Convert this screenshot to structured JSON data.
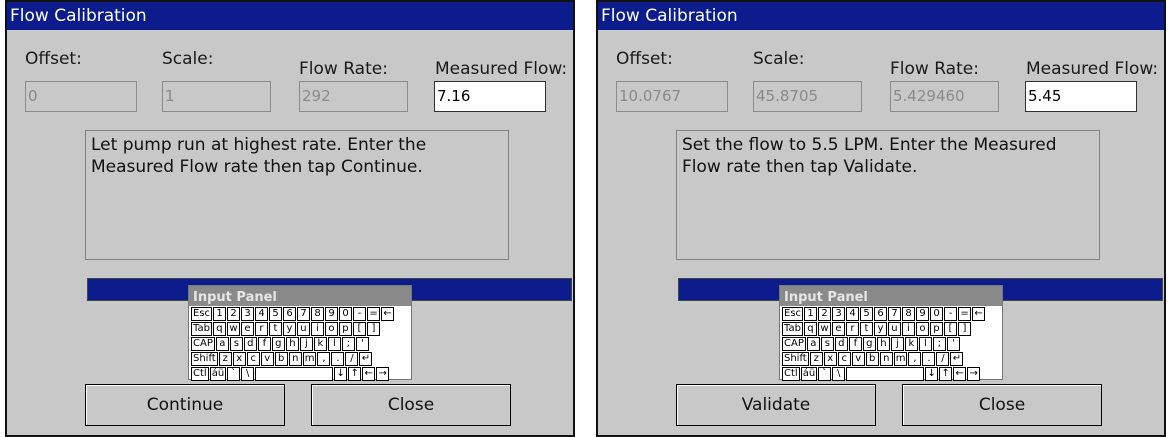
{
  "dialogs": [
    {
      "title": "Flow Calibration",
      "labels": {
        "offset": "Offset:",
        "scale": "Scale:",
        "flow_rate": "Flow Rate:",
        "measured_flow": "Measured Flow:"
      },
      "values": {
        "offset": "0",
        "scale": "1",
        "flow_rate": "292",
        "measured_flow": "7.16"
      },
      "message": "Let pump run at highest rate.  Enter the Measured Flow rate then tap Continue.",
      "buttons": {
        "primary": "Continue",
        "close": "Close"
      }
    },
    {
      "title": "Flow Calibration",
      "labels": {
        "offset": "Offset:",
        "scale": "Scale:",
        "flow_rate": "Flow Rate:",
        "measured_flow": "Measured Flow:"
      },
      "values": {
        "offset": "10.0767",
        "scale": "45.8705",
        "flow_rate": "5.429460",
        "measured_flow": "5.45"
      },
      "message": "Set the flow to  5.5 LPM.  Enter the Measured Flow rate then tap Validate.",
      "buttons": {
        "primary": "Validate",
        "close": "Close"
      }
    }
  ],
  "input_panel": {
    "title": "Input Panel",
    "rows": [
      [
        "Esc",
        "1",
        "2",
        "3",
        "4",
        "5",
        "6",
        "7",
        "8",
        "9",
        "0",
        "-",
        "=",
        "←"
      ],
      [
        "Tab",
        "q",
        "w",
        "e",
        "r",
        "t",
        "y",
        "u",
        "i",
        "o",
        "p",
        "[",
        "]"
      ],
      [
        "CAP",
        "a",
        "s",
        "d",
        "f",
        "g",
        "h",
        "j",
        "k",
        "l",
        ";",
        "'"
      ],
      [
        "Shift",
        "z",
        "x",
        "c",
        "v",
        "b",
        "n",
        "m",
        ",",
        ".",
        "/",
        "↵"
      ],
      [
        "Ctl",
        "áü",
        "`",
        "\\",
        " ",
        "↓",
        "↑",
        "←",
        "→"
      ]
    ]
  }
}
